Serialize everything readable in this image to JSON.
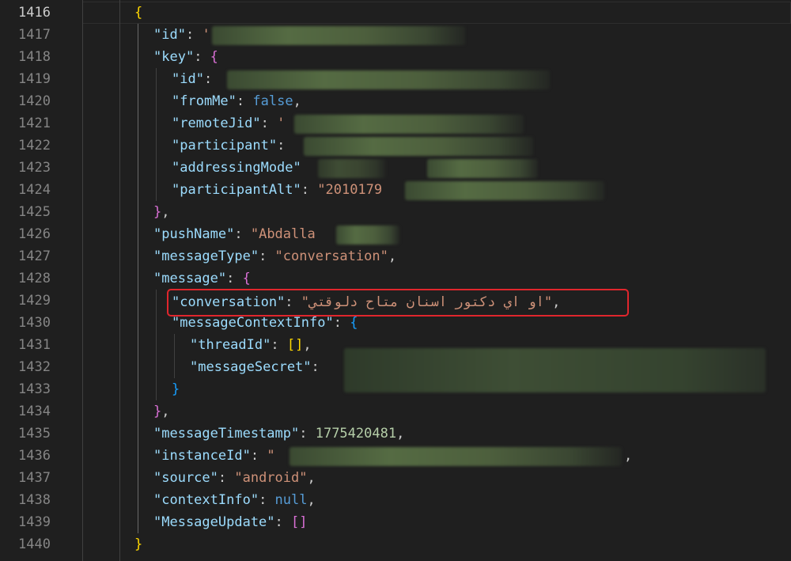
{
  "gutter": {
    "line_numbers": [
      "1416",
      "1417",
      "1418",
      "1419",
      "1420",
      "1421",
      "1422",
      "1423",
      "1424",
      "1425",
      "1426",
      "1427",
      "1428",
      "1429",
      "1430",
      "1431",
      "1432",
      "1433",
      "1434",
      "1435",
      "1436",
      "1437",
      "1438",
      "1439",
      "1440"
    ],
    "active_line": "1416"
  },
  "code": {
    "l1416": {
      "brace": "{"
    },
    "l1417": {
      "key": "\"id\"",
      "colon": ": ",
      "partial": "'"
    },
    "l1418": {
      "key": "\"key\"",
      "colon": ": ",
      "brace": "{"
    },
    "l1419": {
      "key": "\"id\"",
      "colon": ": "
    },
    "l1420": {
      "key": "\"fromMe\"",
      "colon": ": ",
      "value": "false",
      "comma": ","
    },
    "l1421": {
      "key": "\"remoteJid\"",
      "colon": ": ",
      "partial": "'"
    },
    "l1422": {
      "key": "\"participant\"",
      "colon": ": "
    },
    "l1423": {
      "key": "\"addressingMode\""
    },
    "l1424": {
      "key": "\"participantAlt\"",
      "colon": ": ",
      "value": "\"2010179"
    },
    "l1425": {
      "brace": "}",
      "comma": ","
    },
    "l1426": {
      "key": "\"pushName\"",
      "colon": ": ",
      "value": "\"Abdalla"
    },
    "l1427": {
      "key": "\"messageType\"",
      "colon": ": ",
      "value": "\"conversation\"",
      "comma": ","
    },
    "l1428": {
      "key": "\"message\"",
      "colon": ": ",
      "brace": "{"
    },
    "l1429": {
      "key": "\"conversation\"",
      "colon": ": ",
      "value": "\"او اي دكتور اسنان متاح دلوقتي\"",
      "comma": ","
    },
    "l1430": {
      "key": "\"messageContextInfo\"",
      "colon": ": ",
      "brace": "{"
    },
    "l1431": {
      "key": "\"threadId\"",
      "colon": ": ",
      "value": "[]",
      "comma": ","
    },
    "l1432": {
      "key": "\"messageSecret\"",
      "colon": ": "
    },
    "l1433": {
      "brace": "}"
    },
    "l1434": {
      "brace": "}",
      "comma": ","
    },
    "l1435": {
      "key": "\"messageTimestamp\"",
      "colon": ": ",
      "value": "1775420481",
      "comma": ","
    },
    "l1436": {
      "key": "\"instanceId\"",
      "colon": ": ",
      "partial": "\"",
      "trail": ","
    },
    "l1437": {
      "key": "\"source\"",
      "colon": ": ",
      "value": "\"android\"",
      "comma": ","
    },
    "l1438": {
      "key": "\"contextInfo\"",
      "colon": ": ",
      "value": "null",
      "comma": ","
    },
    "l1439": {
      "key": "\"MessageUpdate\"",
      "colon": ": ",
      "value": "[]"
    },
    "l1440": {
      "brace": "}"
    }
  },
  "colors": {
    "background": "#1f1f1f",
    "key": "#9cdcfe",
    "string": "#ce9178",
    "number": "#b5cea8",
    "keyword": "#569cd6",
    "bracket_level1": "#ffd700",
    "bracket_level2": "#da70d6",
    "bracket_level3": "#179fff",
    "highlight_box": "#e0262d"
  }
}
